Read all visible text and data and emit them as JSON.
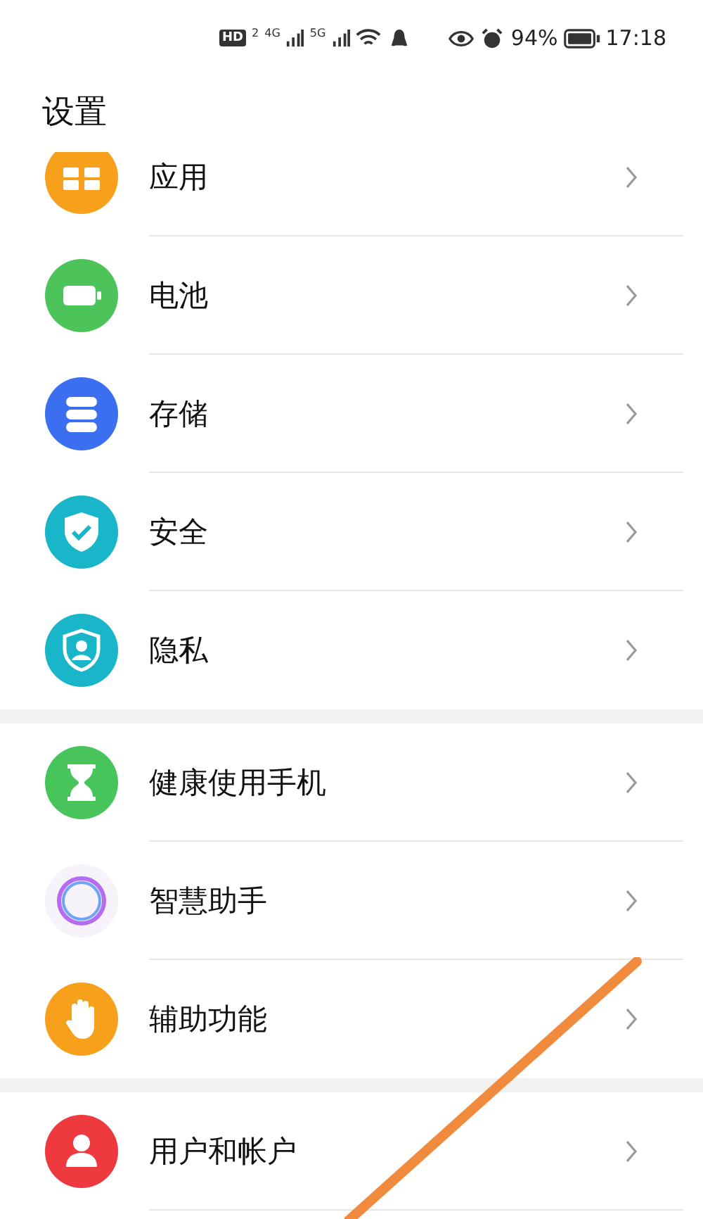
{
  "status_bar": {
    "hd": "HD",
    "sim": "2",
    "networks": [
      "4G",
      "5G"
    ],
    "battery_text": "94%",
    "time": "17:18"
  },
  "title": "设置",
  "groups": [
    {
      "items": [
        {
          "label": "应用",
          "kind": "apps"
        },
        {
          "label": "电池",
          "kind": "battery"
        },
        {
          "label": "存储",
          "kind": "storage"
        },
        {
          "label": "安全",
          "kind": "security"
        },
        {
          "label": "隐私",
          "kind": "privacy"
        }
      ]
    },
    {
      "items": [
        {
          "label": "健康使用手机",
          "kind": "hourglass"
        },
        {
          "label": "智慧助手",
          "kind": "assistant"
        },
        {
          "label": "辅助功能",
          "kind": "hand"
        }
      ]
    },
    {
      "items": [
        {
          "label": "用户和帐户",
          "kind": "user"
        }
      ]
    }
  ]
}
